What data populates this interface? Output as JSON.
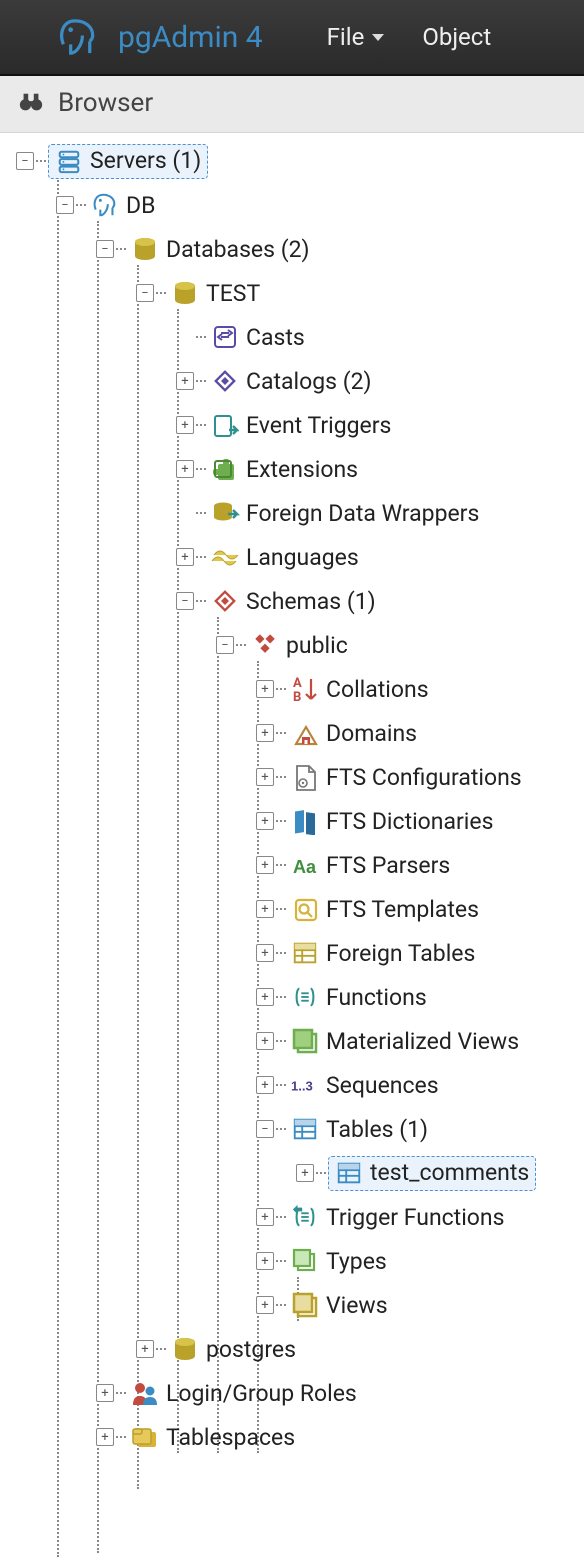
{
  "app": {
    "title": "pgAdmin 4"
  },
  "menu": {
    "file": "File",
    "object": "Object"
  },
  "panel": {
    "title": "Browser"
  },
  "tree": {
    "servers": "Servers (1)",
    "db": "DB",
    "databases": "Databases (2)",
    "test": "TEST",
    "casts": "Casts",
    "catalogs": "Catalogs (2)",
    "event_triggers": "Event Triggers",
    "extensions": "Extensions",
    "fdw": "Foreign Data Wrappers",
    "languages": "Languages",
    "schemas": "Schemas (1)",
    "public": "public",
    "collations": "Collations",
    "domains": "Domains",
    "fts_conf": "FTS Configurations",
    "fts_dict": "FTS Dictionaries",
    "fts_parsers": "FTS Parsers",
    "fts_templates": "FTS Templates",
    "foreign_tables": "Foreign Tables",
    "functions": "Functions",
    "mat_views": "Materialized Views",
    "sequences": "Sequences",
    "tables": "Tables (1)",
    "test_comments": "test_comments",
    "trigger_functions": "Trigger Functions",
    "types": "Types",
    "views": "Views",
    "postgres": "postgres",
    "login_roles": "Login/Group Roles",
    "tablespaces": "Tablespaces"
  }
}
